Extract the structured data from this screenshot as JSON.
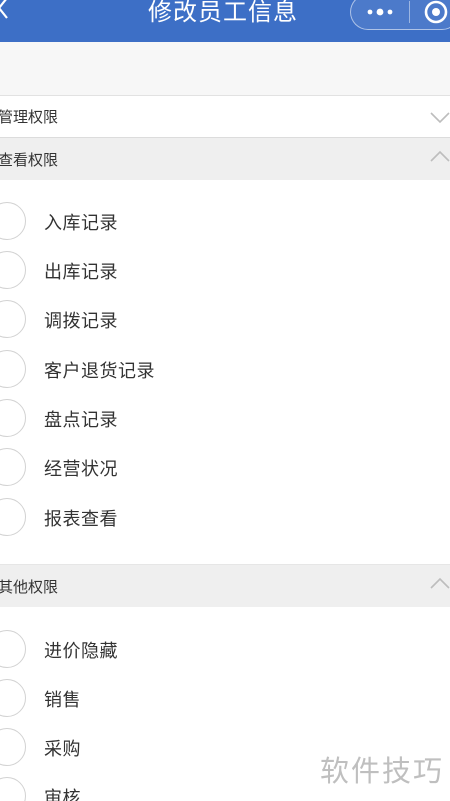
{
  "header": {
    "title": "修改员工信息",
    "background": "#3d6fc6",
    "back_icon": "chevron-left-icon",
    "more_icon": "more-dots-icon",
    "close_icon": "target-circle-icon"
  },
  "sections": [
    {
      "label": "管理权限",
      "state": "collapsed",
      "chevron": "chevron-down-icon"
    },
    {
      "label": "查看权限",
      "state": "expanded",
      "chevron": "chevron-up-icon",
      "items": [
        "入库记录",
        "出库记录",
        "调拨记录",
        "客户退货记录",
        "盘点记录",
        "经营状况",
        "报表查看"
      ]
    },
    {
      "label": "其他权限",
      "state": "expanded",
      "chevron": "chevron-up-icon",
      "items": [
        "进价隐藏",
        "销售",
        "采购",
        "审核"
      ]
    }
  ],
  "watermark": "软件技巧"
}
